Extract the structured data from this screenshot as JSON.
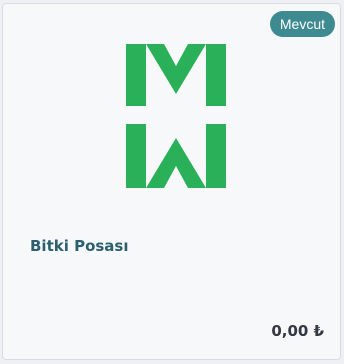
{
  "product": {
    "badge": "Mevcut",
    "logo_icon": "mw-brand-logo",
    "name": "Bitki Posası",
    "price": "0,00 ₺"
  },
  "colors": {
    "badge_bg": "#3d8a91",
    "logo_green": "#2bb05a",
    "title_text": "#2d5f6f",
    "price_text": "#333842"
  }
}
